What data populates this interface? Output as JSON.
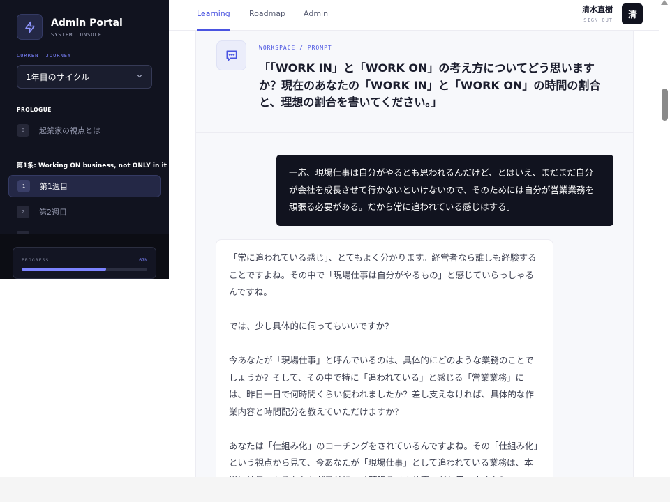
{
  "brand": {
    "title": "Admin Portal",
    "subtitle": "SYSTEM CONSOLE",
    "logo_icon": "lightning-icon"
  },
  "journey": {
    "label": "CURRENT JOURNEY",
    "selected": "1年目のサイクル"
  },
  "sidebar": {
    "prologue_label": "PROLOGUE",
    "prologue_items": [
      {
        "num": "0",
        "label": "起業家の視点とは"
      }
    ],
    "chapter_label": "第1条: Working ON business, not ONLY in it",
    "chapter_items": [
      {
        "num": "1",
        "label": "第1週目",
        "active": true
      },
      {
        "num": "2",
        "label": "第2週目",
        "active": false
      }
    ]
  },
  "progress": {
    "label": "PROGRESS",
    "percent_text": "67%",
    "value": 0.67
  },
  "nav": {
    "tabs": [
      {
        "label": "Learning",
        "active": true
      },
      {
        "label": "Roadmap",
        "active": false
      },
      {
        "label": "Admin",
        "active": false
      }
    ]
  },
  "user": {
    "name": "清水直樹",
    "sign_out": "SIGN OUT",
    "avatar_initial": "清"
  },
  "prompt": {
    "kicker": "WORKSPACE / PROMPT",
    "title": "「「WORK IN」と「WORK ON」の考え方についてどう思いますか？現在のあなたの「WORK IN」と「WORK ON」の時間の割合と、理想の割合を書いてください。」"
  },
  "messages": {
    "user": "一応、現場仕事は自分がやるとも思われるんだけど、とはいえ、まだまだ自分が会社を成長させて行かないといけないので、そのためには自分が営業業務を頑張る必要がある。だから常に追われている感じはする。",
    "assistant": [
      "「常に追われている感じ」、とてもよく分かります。経営者なら誰しも経験することですよね。その中で「現場仕事は自分がやるもの」と感じていらっしゃるんですね。",
      "では、少し具体的に伺ってもいいですか？",
      "今あなたが「現場仕事」と呼んでいるのは、具体的にどのような業務のことでしょうか？そして、その中で特に「追われている」と感じる「営業業務」には、昨日一日で何時間くらい使われましたか？差し支えなければ、具体的な作業内容と時間配分を教えていただけますか？",
      "あなたは「仕組み化」のコーチングをされているんですよね。その「仕組み化」という視点から見て、今あなたが「現場仕事」として追われている業務は、本当に社長であるあなたが最前線で「頑張るべき仕事」だと思いますか？"
    ]
  },
  "colors": {
    "accent": "#4a54e1",
    "sidebar_bg": "#11131f",
    "progress_fill": "#7c83ff"
  }
}
